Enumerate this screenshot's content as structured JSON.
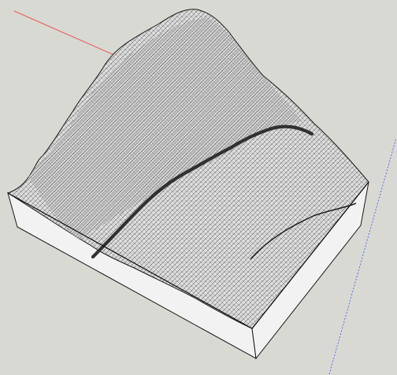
{
  "viewport": {
    "background_color": "#d8d9d3"
  },
  "colors": {
    "axis_red": "#e35b5b",
    "axis_green": "#3a9a3a",
    "axis_blue": "#5b6fe3",
    "mesh_line": "#111111",
    "mesh_fill": "#e7e7e7",
    "side_fill": "#f2f2f2",
    "dark_crevice": "#333333"
  },
  "model": {
    "label": ""
  }
}
